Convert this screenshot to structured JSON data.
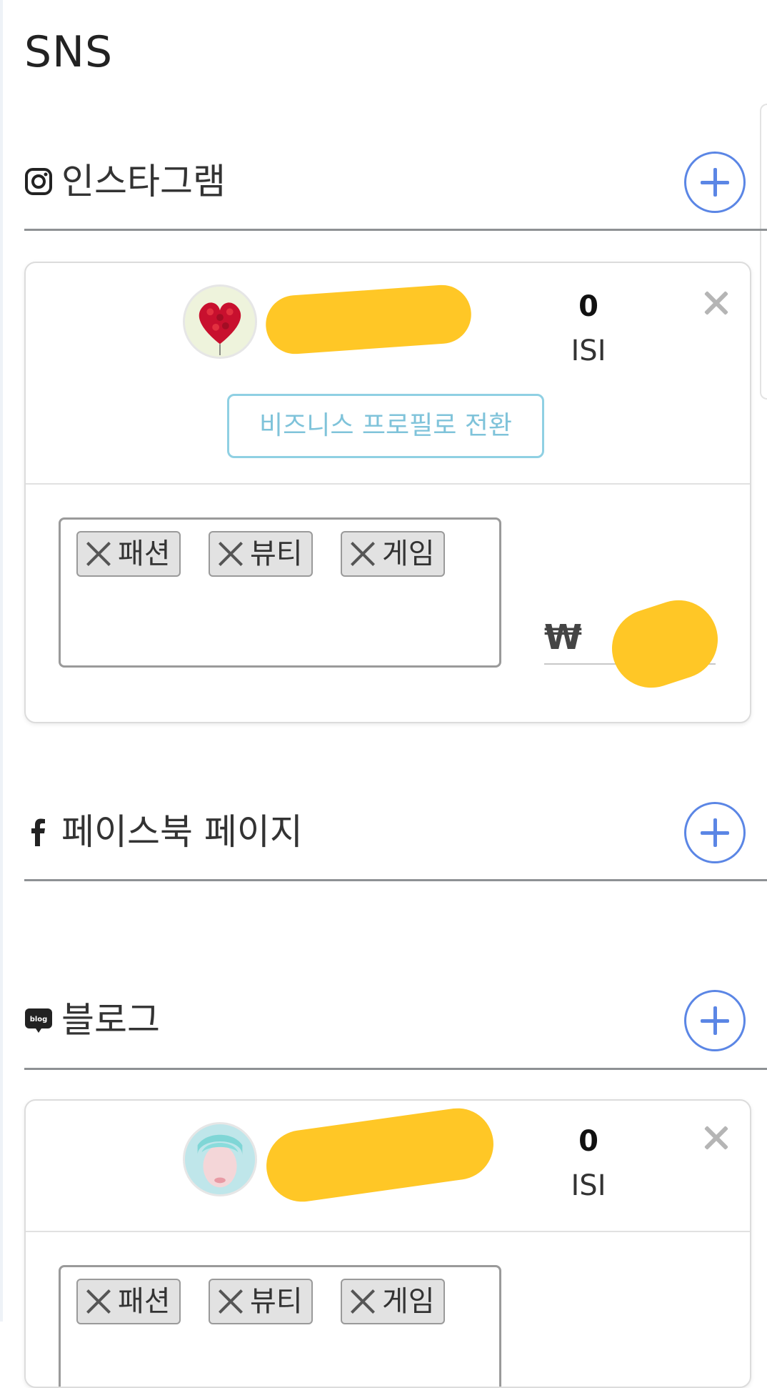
{
  "page": {
    "title": "SNS"
  },
  "instagram": {
    "label": "인스타그램",
    "icon": "instagram-icon",
    "account": {
      "count": "0",
      "count_label": "ISI",
      "business_button": "비즈니스 프로필로 전환",
      "tags": [
        "패션",
        "뷰티",
        "게임"
      ],
      "currency": "₩"
    }
  },
  "facebook": {
    "label": "페이스북 페이지",
    "icon": "facebook-icon"
  },
  "blog": {
    "label": "블로그",
    "icon": "blog-icon",
    "account": {
      "count": "0",
      "count_label": "ISI",
      "tags": [
        "패션",
        "뷰티",
        "게임"
      ]
    }
  },
  "colors": {
    "accent": "#5b86e5",
    "business": "#8fd0e3",
    "redaction": "#ffc726"
  }
}
